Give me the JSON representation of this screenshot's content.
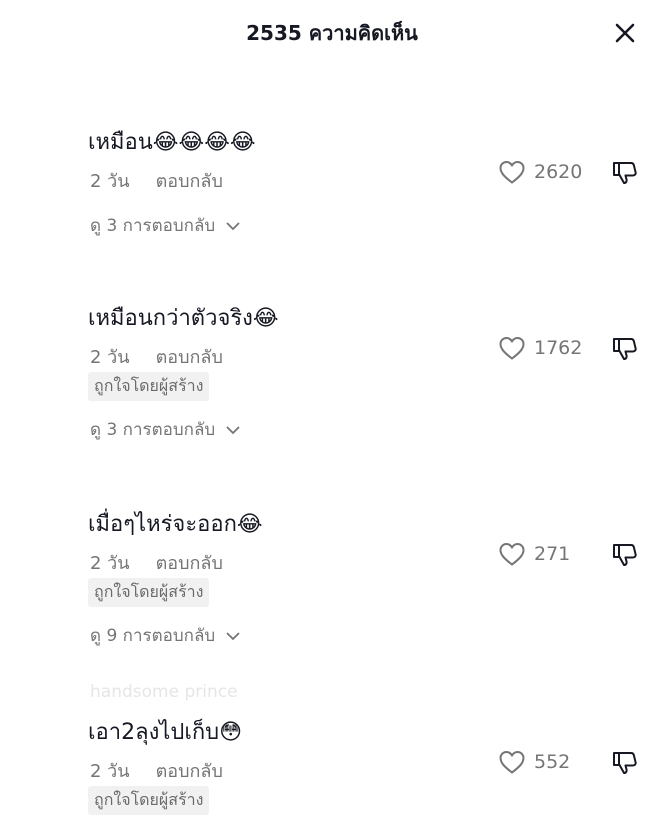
{
  "header": {
    "title": "2535 ความคิดเห็น",
    "close_icon": "close-icon"
  },
  "comments": [
    {
      "text": "เหมือน😂😂😂😂",
      "time": "2 วัน",
      "reply_label": "ตอบกลับ",
      "likes": "2620",
      "creator_liked": "",
      "view_replies": "ดู 3 การตอบกลับ"
    },
    {
      "text": "เหมือนกว่าตัวจริง😂",
      "time": "2 วัน",
      "reply_label": "ตอบกลับ",
      "likes": "1762",
      "creator_liked": "ถูกใจโดยผู้สร้าง",
      "view_replies": "ดู 3 การตอบกลับ"
    },
    {
      "text": "เมื่อๆไหร่จะออก😂",
      "time": "2 วัน",
      "reply_label": "ตอบกลับ",
      "likes": "271",
      "creator_liked": "ถูกใจโดยผู้สร้าง",
      "view_replies": "ดู 9 การตอบกลับ"
    },
    {
      "text": "เอา2ลุงไปเก็บ😳",
      "time": "2 วัน",
      "reply_label": "ตอบกลับ",
      "likes": "552",
      "creator_liked": "ถูกใจโดยผู้สร้าง",
      "view_replies": ""
    }
  ],
  "ghost_username": "handsome prince",
  "colors": {
    "text_primary": "#161823",
    "text_secondary": "#757575",
    "badge_bg": "#f1f1f2"
  }
}
